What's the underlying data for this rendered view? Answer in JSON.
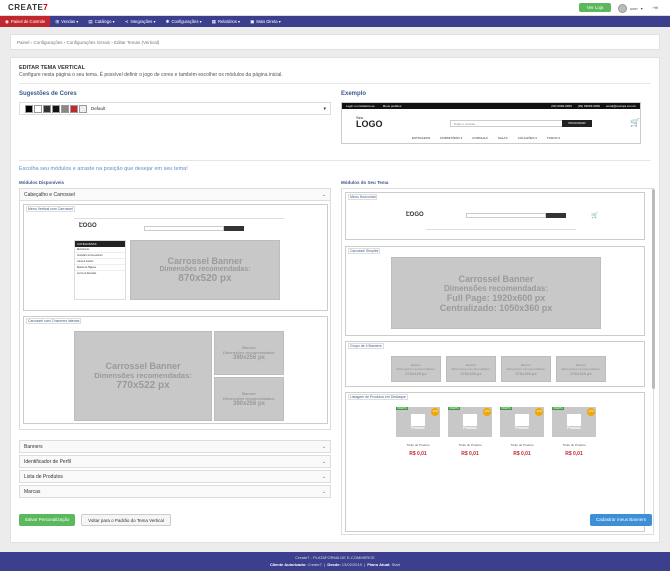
{
  "brand": {
    "logo_text": "CREATE",
    "logo_suffix": "7"
  },
  "topbar": {
    "store_button": "Ver Loja",
    "user_name": "user",
    "exit_icon": "logout-icon"
  },
  "nav": {
    "items": [
      {
        "label": "Painel de Controle",
        "icon": "dashboard-icon",
        "active": true
      },
      {
        "label": "Vendas ▾",
        "icon": "cart-icon"
      },
      {
        "label": "Catálogo ▾",
        "icon": "book-icon"
      },
      {
        "label": "Integrações ▾",
        "icon": "share-icon"
      },
      {
        "label": "Configurações ▾",
        "icon": "gear-icon"
      },
      {
        "label": "Relatórios ▾",
        "icon": "report-icon"
      },
      {
        "label": "Mais Direta ▾",
        "icon": "store-icon"
      }
    ]
  },
  "breadcrumb": "Painel  ›  Configurações  ›  Configurações Gerais  ›  Editar Temas (Vertical)",
  "page": {
    "title": "EDITAR TEMA VERTICAL",
    "description": "Configure nesta página o seu tema. É possível definir o jogo de cores e também escolher os módulos da página inicial.",
    "suggestions_heading": "Sugestões de Cores",
    "color_value": "Default",
    "swatches": [
      "#000000",
      "#ffffff",
      "#333333",
      "#111111",
      "#888888",
      "#c0282e",
      "#eeeeee"
    ],
    "example_heading": "Exemplo",
    "choose_text": "Escolha seu módulos e arraste na posição que desejar em seu tema!",
    "available_heading": "Módulos Disponíveis",
    "mine_heading": "Módulos do Seu Tema"
  },
  "example": {
    "topbar_left": [
      "Login ou Cadastre-se",
      "Meus pedidos"
    ],
    "topbar_right": [
      "(99) 9999-9999",
      "(99) 99999-9999",
      "email@suaroja.com.br"
    ],
    "logo_small": "Seu",
    "logo_big": "LOGO",
    "search_placeholder": "Digite o produto...",
    "search_button": "PROCURAR",
    "menu": [
      "ESTOFADOS",
      "DORMITÓRIO ▾",
      "COZINHA ▾",
      "SALA ▾",
      "COLCHÕES ▾",
      "TODOS ▾"
    ]
  },
  "available": {
    "accordion_open": "Cabeçalho e Carrossel",
    "module_vertical": "Menu Vertical com Carrossel",
    "module_vertical_text": [
      "Carrossel Banner",
      "Dimensões recomendadas:",
      "870x520 px"
    ],
    "categorias": [
      "CATEGORIAS",
      "Eletrônicos",
      "Vestuário & Acessórios",
      "Casa & Jardim",
      "Beleza & Higiene",
      "Livros & Revistas"
    ],
    "module_side": "Carrossel com 2 banners laterais",
    "module_side_text": [
      "Carrossel Banner",
      "Dimensões recomendadas:",
      "770x522 px"
    ],
    "side_banner": [
      "Banner",
      "Dimensões recomendadas:",
      "390x256 px"
    ],
    "accordions": [
      "Banners",
      "Identificador de Perfil",
      "Lista de Produtos",
      "Marcas"
    ]
  },
  "mine": {
    "module_horizontal": "Menu Horizontal",
    "module_simple": "Carrossel Simples",
    "simple_text": [
      "Carrossel Banner",
      "Dimensões recomendadas:",
      "Full Page: 1920x600 px",
      "Centralizado: 1050x360 px"
    ],
    "module_four": "Grupo de 4 Banners",
    "four_text": [
      "Banner",
      "Dimensões recomendadas:",
      "276x128 px"
    ],
    "module_products": "Listagem de Produtos em Destaque",
    "product": {
      "tag": "OFERTA",
      "discount": "-10%",
      "label": "Produto",
      "title": "Título do Produto",
      "price": "R$ 0,01"
    }
  },
  "buttons": {
    "save": "Salvar Personalização",
    "reset": "Voltar para o Padrão do Tema Vertical",
    "banners": "Cadastrar meus Banners"
  },
  "footer": {
    "line1": "Create7 - PLATAFORMA DE E-COMMERCE",
    "client_label": "Cliente Autorizado:",
    "client": "Create7",
    "since_label": "Desde:",
    "since": "13/02/2019",
    "plan_label": "Plano Atual:",
    "plan": "Start"
  }
}
